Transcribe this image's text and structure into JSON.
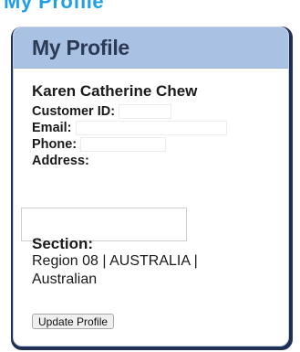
{
  "page": {
    "partial_heading": "My Profile"
  },
  "profile": {
    "title": "My Profile",
    "name": "Karen Catherine Chew",
    "customer_id_label": "Customer ID:",
    "email_label": "Email:",
    "phone_label": "Phone:",
    "address_label": "Address:",
    "section_label": "Section:",
    "section_value": "Region 08 | AUSTRALIA | Australian",
    "update_button": "Update Profile"
  },
  "colors": {
    "header_bg": "#a9c1e3",
    "accent_blue": "#1f9fe6",
    "card_shadow": "#1f2f55"
  }
}
